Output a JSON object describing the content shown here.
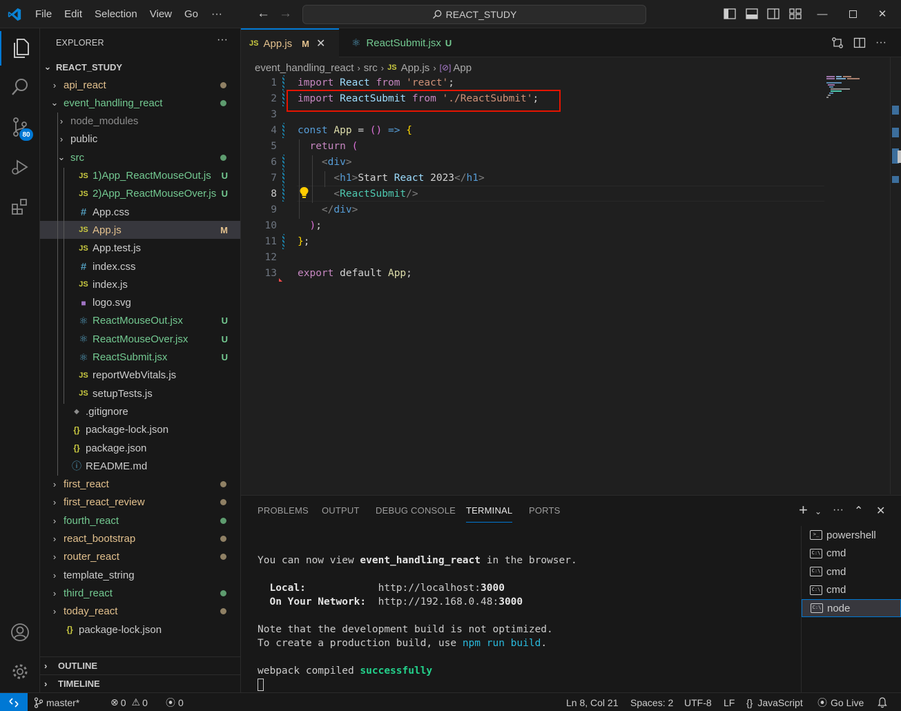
{
  "titlebar": {
    "menus": [
      "File",
      "Edit",
      "Selection",
      "View",
      "Go"
    ],
    "more": "···",
    "search_text": "REACT_STUDY"
  },
  "activity": {
    "scm_badge": "80"
  },
  "sidebar": {
    "title": "EXPLORER",
    "more": "···",
    "root": "REACT_STUDY",
    "rows": [
      {
        "label": "api_react",
        "chev": "›",
        "color": "#e2c08d"
      },
      {
        "label": "event_handling_react",
        "chev": "⌄",
        "color": "#73c991"
      },
      {
        "label": "node_modules",
        "chev": "›",
        "color": "#8c8c8c"
      },
      {
        "label": "public",
        "chev": "›",
        "color": "#cccccc"
      },
      {
        "label": "src",
        "chev": "⌄",
        "color": "#73c991"
      },
      {
        "label": "1)App_ReactMouseOut.js",
        "icon": "JS",
        "status": "U",
        "color": "#73c991"
      },
      {
        "label": "2)App_ReactMouseOver.js",
        "icon": "JS",
        "status": "U",
        "color": "#73c991"
      },
      {
        "label": "App.css",
        "icon": "#",
        "color": "#cccccc"
      },
      {
        "label": "App.js",
        "icon": "JS",
        "status": "M",
        "color": "#e2c08d"
      },
      {
        "label": "App.test.js",
        "icon": "JS",
        "color": "#cccccc"
      },
      {
        "label": "index.css",
        "icon": "#",
        "color": "#cccccc"
      },
      {
        "label": "index.js",
        "icon": "JS",
        "color": "#cccccc"
      },
      {
        "label": "logo.svg",
        "icon": "svg",
        "color": "#cccccc"
      },
      {
        "label": "ReactMouseOut.jsx",
        "icon": "react",
        "status": "U",
        "color": "#73c991"
      },
      {
        "label": "ReactMouseOver.jsx",
        "icon": "react",
        "status": "U",
        "color": "#73c991"
      },
      {
        "label": "ReactSubmit.jsx",
        "icon": "react",
        "status": "U",
        "color": "#73c991"
      },
      {
        "label": "reportWebVitals.js",
        "icon": "JS",
        "color": "#cccccc"
      },
      {
        "label": "setupTests.js",
        "icon": "JS",
        "color": "#cccccc"
      },
      {
        "label": ".gitignore",
        "icon": "git",
        "color": "#cccccc"
      },
      {
        "label": "package-lock.json",
        "icon": "{}",
        "color": "#cccccc"
      },
      {
        "label": "package.json",
        "icon": "{}",
        "color": "#cccccc"
      },
      {
        "label": "README.md",
        "icon": "ⓘ",
        "color": "#cccccc"
      },
      {
        "label": "first_react",
        "chev": "›",
        "color": "#e2c08d"
      },
      {
        "label": "first_react_review",
        "chev": "›",
        "color": "#e2c08d"
      },
      {
        "label": "fourth_react",
        "chev": "›",
        "color": "#73c991"
      },
      {
        "label": "react_bootstrap",
        "chev": "›",
        "color": "#e2c08d"
      },
      {
        "label": "router_react",
        "chev": "›",
        "color": "#e2c08d"
      },
      {
        "label": "template_string",
        "chev": "›",
        "color": "#cccccc"
      },
      {
        "label": "third_react",
        "chev": "›",
        "color": "#73c991"
      },
      {
        "label": "today_react",
        "chev": "›",
        "color": "#e2c08d"
      },
      {
        "label": "package-lock.json",
        "icon": "{}",
        "color": "#cccccc"
      }
    ],
    "outline": "OUTLINE",
    "timeline": "TIMELINE"
  },
  "tabs": [
    {
      "label": "App.js",
      "icon": "JS",
      "status": "M"
    },
    {
      "label": "ReactSubmit.jsx",
      "icon": "react",
      "status": "U"
    }
  ],
  "breadcrumb": [
    "event_handling_react",
    "src",
    "App.js",
    "App"
  ],
  "code": {
    "line_numbers": [
      "1",
      "2",
      "3",
      "4",
      "5",
      "6",
      "7",
      "8",
      "9",
      "10",
      "11",
      "12",
      "13"
    ],
    "lines": [
      "import React from 'react';",
      "import ReactSubmit from './ReactSubmit';",
      "",
      "const App = () => {",
      "  return (",
      "    <div>",
      "      <h1>Start React 2023</h1>",
      "      <ReactSubmit/>",
      "    </div>",
      "  );",
      "};",
      "",
      "export default App;"
    ]
  },
  "panel": {
    "tabs": [
      "PROBLEMS",
      "OUTPUT",
      "DEBUG CONSOLE",
      "TERMINAL",
      "PORTS"
    ],
    "active_tab": "TERMINAL",
    "terminal": {
      "l1_a": "You can now view ",
      "l1_b": "event_handling_react",
      "l1_c": " in the browser.",
      "local_label": "  Local:",
      "local_url": "http://localhost:",
      "local_port": "3000",
      "net_label": "  On Your Network:",
      "net_url": "http://192.168.0.48:",
      "net_port": "3000",
      "note1": "Note that the development build is not optimized.",
      "note2_a": "To create a production build, use ",
      "note2_b": "npm run build",
      "note2_c": ".",
      "webpack_a": "webpack compiled ",
      "webpack_b": "successfully"
    },
    "terminals": [
      "powershell",
      "cmd",
      "cmd",
      "cmd",
      "node"
    ]
  },
  "status": {
    "branch": "master*",
    "errors": "0",
    "warnings": "0",
    "ports": "0",
    "position": "Ln 8, Col 21",
    "spaces": "Spaces: 2",
    "encoding": "UTF-8",
    "eol": "LF",
    "language": "JavaScript",
    "golive": "Go Live"
  }
}
